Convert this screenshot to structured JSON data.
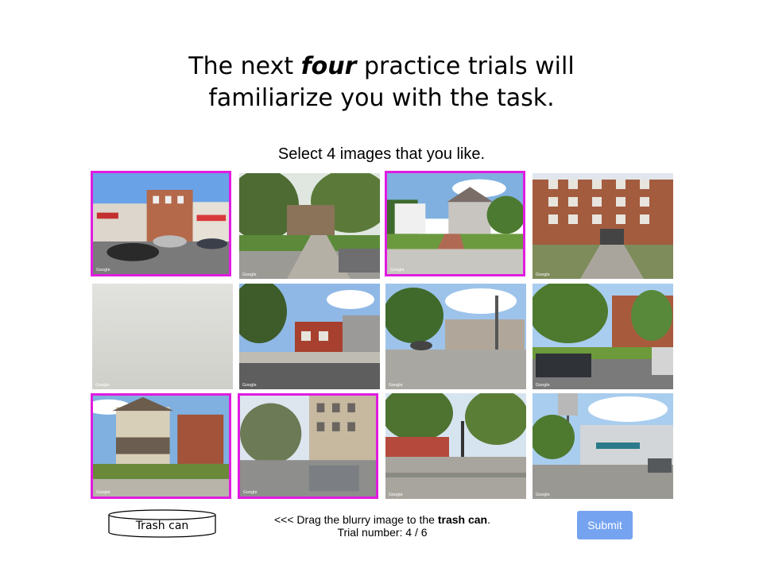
{
  "headline": {
    "line1_before": "The next ",
    "line1_emph": "four",
    "line1_after": " practice trials will",
    "line2": "familiarize you with the task."
  },
  "instruction": "Select 4 images that you like.",
  "images": [
    {
      "name": "image-tile-1",
      "scene": "storefront street with parked cars",
      "selected": true,
      "credit": "Google"
    },
    {
      "name": "image-tile-2",
      "scene": "tree-lined residential path with car",
      "selected": false,
      "credit": "Google"
    },
    {
      "name": "image-tile-3",
      "scene": "victorian houses with brick walkway",
      "selected": true,
      "credit": "Google"
    },
    {
      "name": "image-tile-4",
      "scene": "brick apartment building with driveway",
      "selected": false,
      "credit": "Google"
    },
    {
      "name": "image-tile-5",
      "scene": "blurry gray image",
      "selected": false,
      "credit": "Google"
    },
    {
      "name": "image-tile-6",
      "scene": "street corner with small shops",
      "selected": false,
      "credit": "Google"
    },
    {
      "name": "image-tile-7",
      "scene": "parking lot with utility pole",
      "selected": false,
      "credit": "Google"
    },
    {
      "name": "image-tile-8",
      "scene": "street with pickup truck and trees",
      "selected": false,
      "credit": "Google"
    },
    {
      "name": "image-tile-9",
      "scene": "house with porch",
      "selected": true,
      "credit": "Google"
    },
    {
      "name": "image-tile-10",
      "scene": "apartment building with parked car",
      "selected": true,
      "credit": "Google"
    },
    {
      "name": "image-tile-11",
      "scene": "intersection with trees",
      "selected": false,
      "credit": "Google"
    },
    {
      "name": "image-tile-12",
      "scene": "commercial building with billboard",
      "selected": false,
      "credit": "Google"
    }
  ],
  "trash_label": "Trash can",
  "drag_hint": {
    "before": "<<< Drag the blurry image to the ",
    "bold": "trash can",
    "after": "."
  },
  "trial_text": "Trial number: 4 / 6",
  "submit_label": "Submit",
  "colors": {
    "selection_border": "#e01ce0",
    "submit_bg": "#75a3f0"
  }
}
